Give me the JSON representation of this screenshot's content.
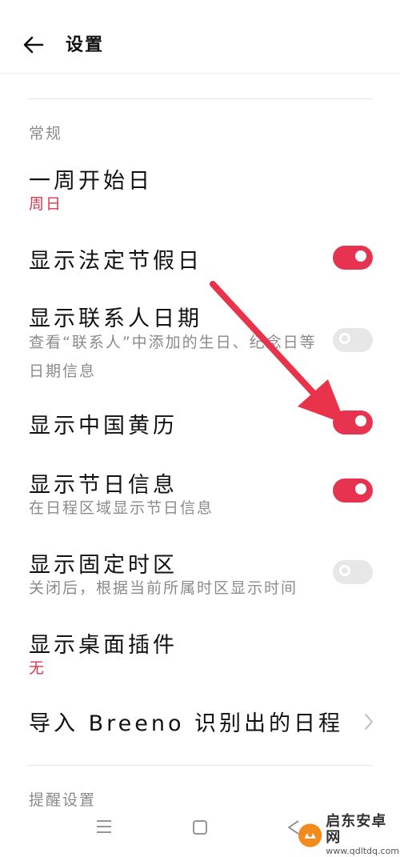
{
  "header": {
    "title": "设置"
  },
  "sections": {
    "general_label": "常规",
    "reminder_label": "提醒设置"
  },
  "rows": [
    {
      "title": "一周开始日",
      "subtitle": "周日",
      "control": "value"
    },
    {
      "title": "显示法定节假日",
      "subtitle": "",
      "control": "toggle",
      "on": true
    },
    {
      "title": "显示联系人日期",
      "subtitle": "查看“联系人”中添加的生日、纪念日等日期信息",
      "control": "toggle",
      "on": false
    },
    {
      "title": "显示中国黄历",
      "subtitle": "",
      "control": "toggle",
      "on": true
    },
    {
      "title": "显示节日信息",
      "subtitle": "在日程区域显示节日信息",
      "control": "toggle",
      "on": true
    },
    {
      "title": "显示固定时区",
      "subtitle": "关闭后，根据当前所属时区显示时间",
      "control": "toggle",
      "on": false
    },
    {
      "title": "显示桌面插件",
      "subtitle": "无",
      "control": "value"
    },
    {
      "title": "导入 Breeno 识别出的日程",
      "subtitle": "",
      "control": "chevron"
    }
  ],
  "navbar": {
    "icons": [
      "menu-icon",
      "home-square-icon",
      "back-triangle-icon"
    ]
  },
  "watermark": {
    "name": "启东安卓网",
    "url": "www.qdltdq.com"
  },
  "colors": {
    "accent": "#e53350",
    "toggle_off": "#e7e7e7",
    "value_text": "#d7384c",
    "annotation_arrow": "#e8334a"
  }
}
